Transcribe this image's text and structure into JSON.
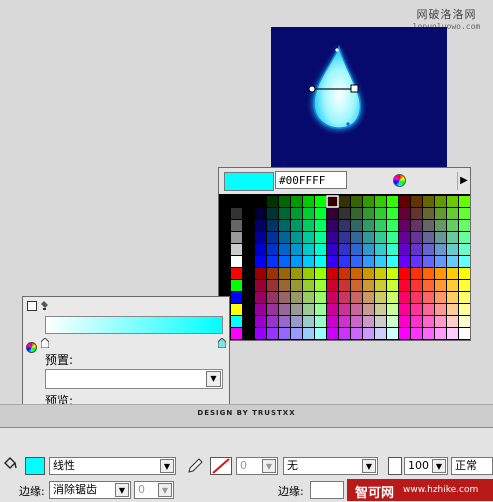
{
  "watermark": {
    "name": "网破洛洛网",
    "url": "lopuoluowo.com"
  },
  "swatch_panel": {
    "hex_value": "#00FFFF",
    "current_color": "#00ffff",
    "menu_arrow": "▶"
  },
  "fill_panel": {
    "preset_label": "预置:",
    "preset_value": "",
    "preview_label": "预览:",
    "gradient_start": "#ffffff",
    "gradient_end": "#00ffff"
  },
  "design_credit": "DESIGN BY TRUSTXX",
  "properties": {
    "fill_type": "线性",
    "stroke_alpha": "0",
    "stroke_style": "无",
    "alpha_value": "100",
    "blend_mode": "正常",
    "edge_label": "边缘:",
    "edge_value": "消除锯齿",
    "edge_alpha": "0",
    "edge_label2": "边缘:"
  },
  "site_banner": {
    "name": "智可网",
    "url": "www.hzhike.com"
  }
}
